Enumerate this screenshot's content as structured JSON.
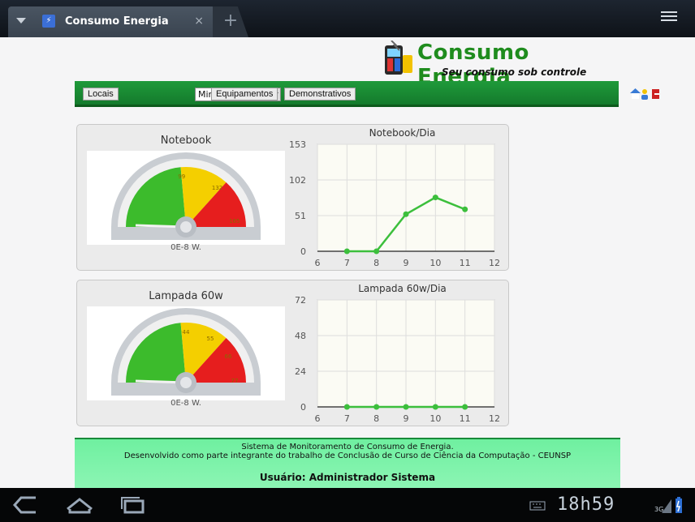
{
  "browser": {
    "tab_title": "Consumo Energia",
    "close_glyph": "×",
    "new_tab_glyph": "+"
  },
  "logo": {
    "title": "Consumo Energia",
    "subtitle": "Seu consumo sob controle"
  },
  "nav": {
    "locais": "Locais",
    "select_value": "Minha Residencia",
    "equipamentos": "Equipamentos",
    "demonstrativos": "Demonstrativos",
    "icons": [
      "home-icon",
      "users-icon",
      "exit-icon"
    ]
  },
  "panels": [
    {
      "gauge_title": "Notebook",
      "gauge_value": "0E-8 W.",
      "gauge_ticks": [
        "99",
        "132",
        "165"
      ],
      "chart_data": {
        "type": "line",
        "title": "Notebook/Dia",
        "x": [
          7,
          8,
          9,
          10,
          11
        ],
        "values": [
          0,
          0,
          53,
          77,
          60
        ],
        "xlim": [
          6,
          12
        ],
        "ylim": [
          0,
          153
        ],
        "yticks": [
          0,
          51,
          102,
          153
        ],
        "xticks": [
          6,
          7,
          8,
          9,
          10,
          11,
          12
        ],
        "color": "#3cbf3c",
        "grid": true
      }
    },
    {
      "gauge_title": "Lampada 60w",
      "gauge_value": "0E-8 W.",
      "gauge_ticks": [
        "44",
        "55",
        "66",
        "77"
      ],
      "chart_data": {
        "type": "line",
        "title": "Lampada 60w/Dia",
        "x": [
          7,
          8,
          9,
          10,
          11
        ],
        "values": [
          0,
          0,
          0,
          0,
          0
        ],
        "xlim": [
          6,
          12
        ],
        "ylim": [
          0,
          72
        ],
        "yticks": [
          0,
          24,
          48,
          72
        ],
        "xticks": [
          6,
          7,
          8,
          9,
          10,
          11,
          12
        ],
        "color": "#3cbf3c",
        "grid": true
      }
    }
  ],
  "footer": {
    "line1": "Sistema de Monitoramento de Consumo de Energia.",
    "line2": "Desenvolvido como parte integrante do trabalho de Conclusão de Curso de Ciência da Computação - CEUNSP",
    "user": "Usuário: Administrador Sistema"
  },
  "system": {
    "clock": "18h59",
    "network": "3G"
  }
}
